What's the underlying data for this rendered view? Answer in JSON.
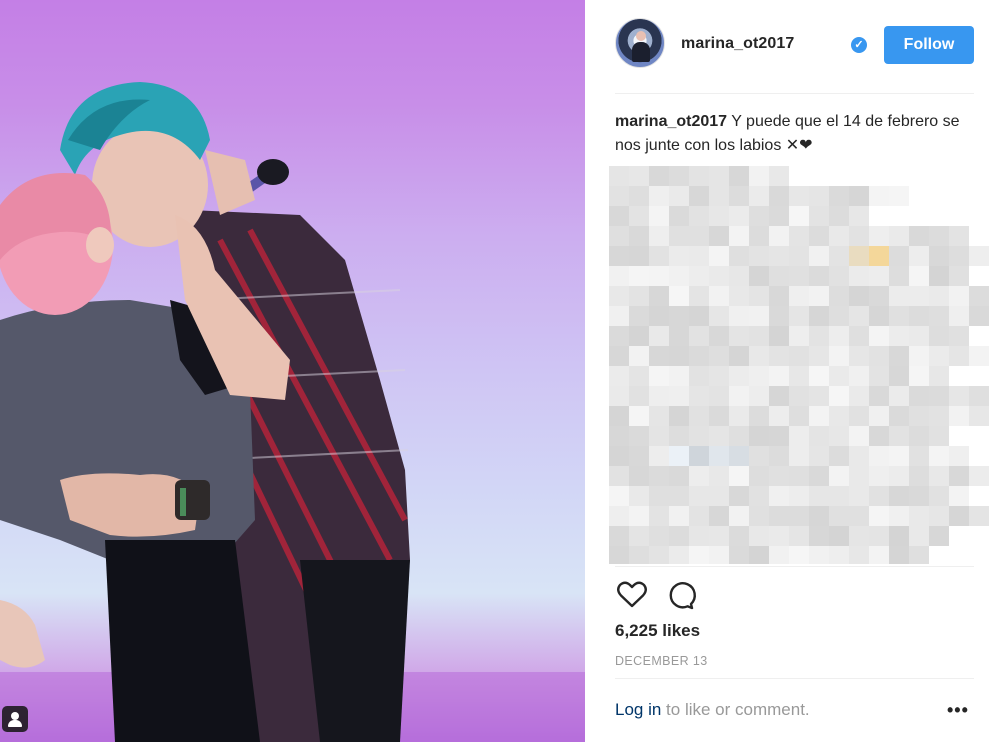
{
  "post": {
    "username": "marina_ot2017",
    "verified_icon": "verified-check-icon",
    "follow_label": "Follow",
    "caption_user": "marina_ot2017",
    "caption_text": " Y puede que el 14 de febrero se nos junte con los labios ✕❤",
    "likes": "6,225 likes",
    "date": "DECEMBER 13",
    "login_link": "Log in",
    "login_rest": " to like or comment.",
    "more_label": "•••"
  },
  "icons": {
    "heart": "heart-icon",
    "comment": "comment-icon",
    "tag": "user-tag-icon",
    "more": "more-options-icon"
  },
  "colors": {
    "accent": "#3897f0",
    "link": "#003569",
    "muted": "#999999",
    "text": "#262626"
  }
}
